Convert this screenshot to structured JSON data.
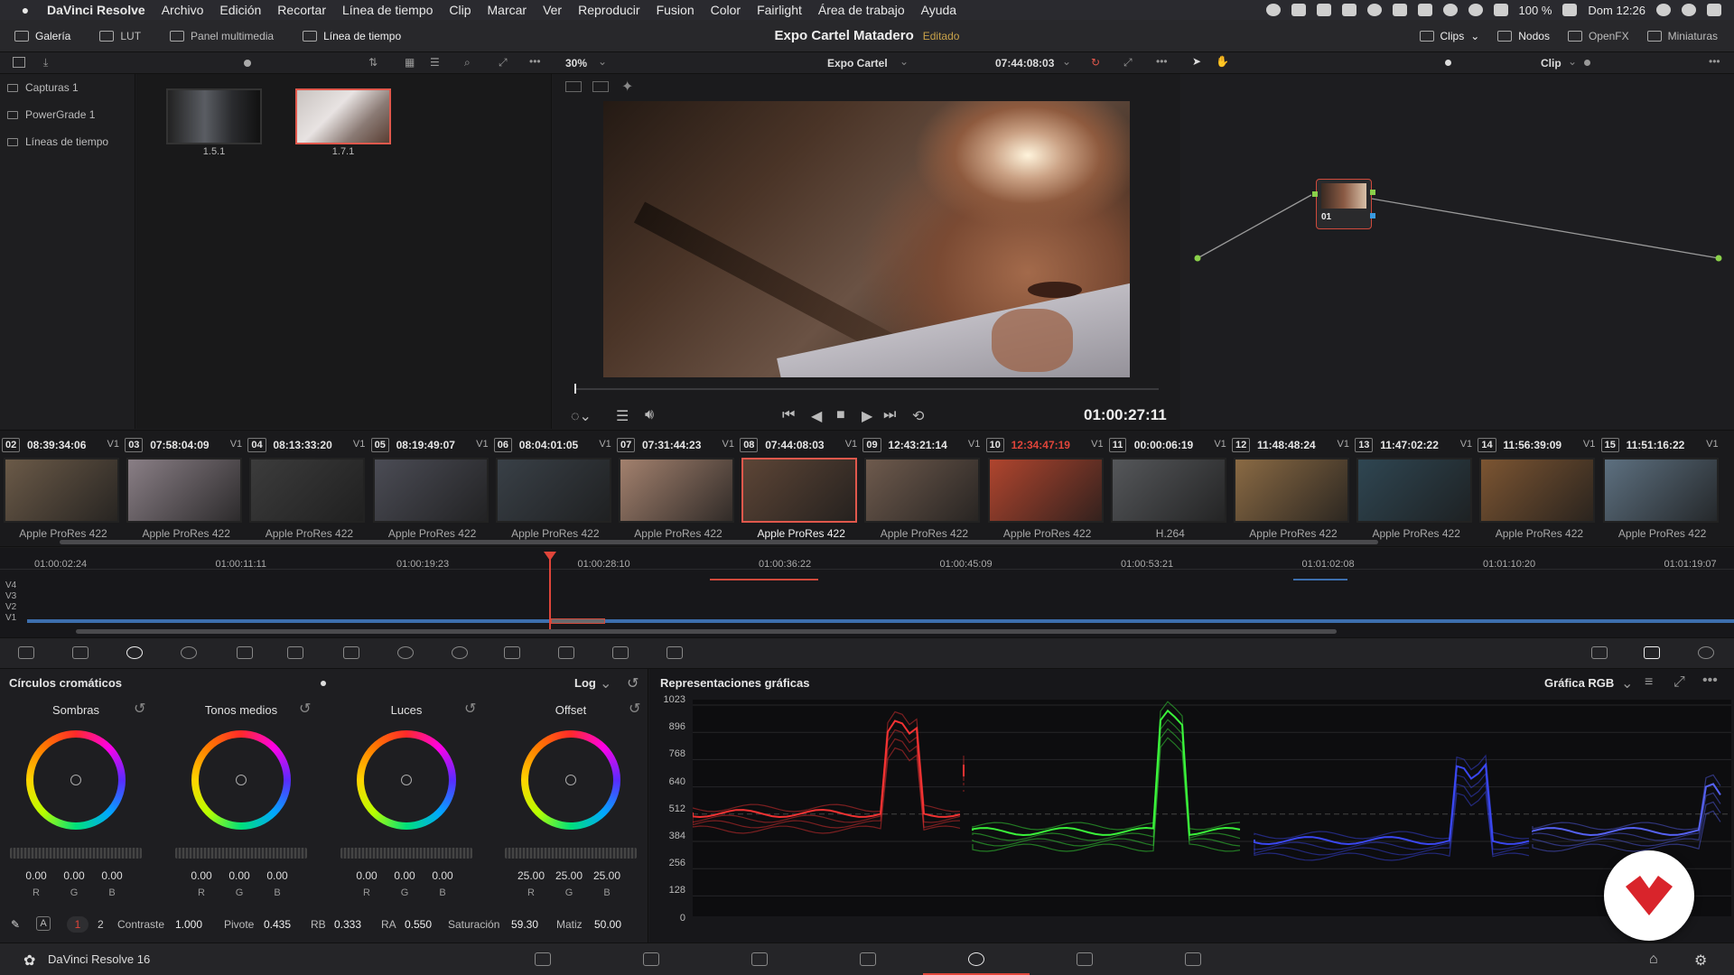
{
  "menubar": {
    "app": "DaVinci Resolve",
    "items": [
      "Archivo",
      "Edición",
      "Recortar",
      "Línea de tiempo",
      "Clip",
      "Marcar",
      "Ver",
      "Reproducir",
      "Fusion",
      "Color",
      "Fairlight",
      "Área de trabajo",
      "Ayuda"
    ],
    "battery": "100 %",
    "clock": "Dom 12:26"
  },
  "toolbar": {
    "gallery": "Galería",
    "lut": "LUT",
    "media": "Panel multimedia",
    "timeline": "Línea de tiempo",
    "project": "Expo Cartel Matadero",
    "status": "Editado",
    "clips": "Clips",
    "nodes": "Nodos",
    "openfx": "OpenFX",
    "thumbs": "Miniaturas"
  },
  "subbar": {
    "zoom": "30%",
    "timeline_name": "Expo Cartel",
    "timecode": "07:44:08:03",
    "mode": "Clip"
  },
  "albums": [
    "Capturas 1",
    "PowerGrade 1",
    "Líneas de tiempo"
  ],
  "stills": [
    {
      "label": "1.5.1",
      "selected": false
    },
    {
      "label": "1.7.1",
      "selected": true
    }
  ],
  "viewer": {
    "timecode": "01:00:27:11"
  },
  "node": {
    "label": "01"
  },
  "clips": [
    {
      "num": "02",
      "tc": "08:39:34:06",
      "track": "V1",
      "codec": "Apple ProRes 422",
      "tint": "#6b5a48"
    },
    {
      "num": "03",
      "tc": "07:58:04:09",
      "track": "V1",
      "codec": "Apple ProRes 422",
      "tint": "#8a7f86"
    },
    {
      "num": "04",
      "tc": "08:13:33:20",
      "track": "V1",
      "codec": "Apple ProRes 422",
      "tint": "#3c3c3c"
    },
    {
      "num": "05",
      "tc": "08:19:49:07",
      "track": "V1",
      "codec": "Apple ProRes 422",
      "tint": "#4b4c55"
    },
    {
      "num": "06",
      "tc": "08:04:01:05",
      "track": "V1",
      "codec": "Apple ProRes 422",
      "tint": "#394047"
    },
    {
      "num": "07",
      "tc": "07:31:44:23",
      "track": "V1",
      "codec": "Apple ProRes 422",
      "tint": "#a3816e"
    },
    {
      "num": "08",
      "tc": "07:44:08:03",
      "track": "V1",
      "codec": "Apple ProRes 422",
      "tint": "#5d4536",
      "selected": true
    },
    {
      "num": "09",
      "tc": "12:43:21:14",
      "track": "V1",
      "codec": "Apple ProRes 422",
      "tint": "#6e5a4d"
    },
    {
      "num": "10",
      "tc": "12:34:47:19",
      "track": "V1",
      "codec": "Apple ProRes 422",
      "tint": "#b0452e",
      "red": true
    },
    {
      "num": "11",
      "tc": "00:00:06:19",
      "track": "V1",
      "codec": "H.264",
      "tint": "#55575a"
    },
    {
      "num": "12",
      "tc": "11:48:48:24",
      "track": "V1",
      "codec": "Apple ProRes 422",
      "tint": "#8a6a44"
    },
    {
      "num": "13",
      "tc": "11:47:02:22",
      "track": "V1",
      "codec": "Apple ProRes 422",
      "tint": "#2f4652"
    },
    {
      "num": "14",
      "tc": "11:56:39:09",
      "track": "V1",
      "codec": "Apple ProRes 422",
      "tint": "#7c5532"
    },
    {
      "num": "15",
      "tc": "11:51:16:22",
      "track": "V1",
      "codec": "Apple ProRes 422",
      "tint": "#5d7080"
    }
  ],
  "timeline": {
    "ticks": [
      "01:00:02:24",
      "01:00:11:11",
      "01:00:19:23",
      "01:00:28:10",
      "01:00:36:22",
      "01:00:45:09",
      "01:00:53:21",
      "01:01:02:08",
      "01:01:10:20",
      "01:01:19:07"
    ],
    "tracks": [
      "V4",
      "V3",
      "V2",
      "V1"
    ]
  },
  "wheels": {
    "title": "Círculos cromáticos",
    "mode": "Log",
    "items": [
      {
        "name": "Sombras",
        "values": [
          "0.00",
          "0.00",
          "0.00"
        ]
      },
      {
        "name": "Tonos medios",
        "values": [
          "0.00",
          "0.00",
          "0.00"
        ]
      },
      {
        "name": "Luces",
        "values": [
          "0.00",
          "0.00",
          "0.00"
        ]
      },
      {
        "name": "Offset",
        "values": [
          "25.00",
          "25.00",
          "25.00"
        ]
      }
    ],
    "channel_labels": [
      "R",
      "G",
      "B"
    ],
    "footer": {
      "page1": "1",
      "page2": "2",
      "contrast_label": "Contraste",
      "contrast": "1.000",
      "pivot_label": "Pivote",
      "pivot": "0.435",
      "rb_label": "RB",
      "rb": "0.333",
      "ra_label": "RA",
      "ra": "0.550",
      "sat_label": "Saturación",
      "sat": "59.30",
      "hue_label": "Matiz",
      "hue": "50.00"
    }
  },
  "scopes": {
    "title": "Representaciones gráficas",
    "mode": "Gráfica RGB",
    "yticks": [
      "1023",
      "896",
      "768",
      "640",
      "512",
      "384",
      "256",
      "128",
      "0"
    ]
  },
  "pagebar": {
    "label": "DaVinci Resolve 16"
  }
}
